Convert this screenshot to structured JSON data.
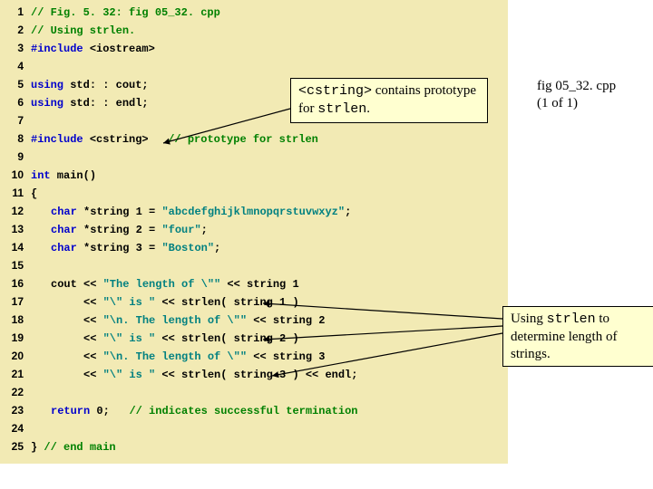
{
  "file_label": {
    "name": "fig 05_32. cpp",
    "page": "(1 of 1)"
  },
  "callouts": {
    "c1_a": "<cstring>",
    "c1_b": " contains prototype for ",
    "c1_c": "strlen",
    "c1_d": ".",
    "c2_a": "Using ",
    "c2_b": "strlen",
    "c2_c": " to determine length of strings."
  },
  "code": {
    "l1": "// Fig. 5. 32: fig 05_32. cpp",
    "l2": "// Using strlen.",
    "l3a": "#include ",
    "l3b": "<iostream>",
    "l5a": "using ",
    "l5b": "std: : cout;",
    "l6a": "using ",
    "l6b": "std: : endl;",
    "l8a": "#include ",
    "l8b": "<cstring>",
    "l8c": "   ",
    "l8d": "// prototype for strlen",
    "l10a": "int",
    "l10b": " main()",
    "l11": "{",
    "l12a": "char",
    "l12b": " *string 1 = ",
    "l12c": "\"abcdefghijklmnopqrstuvwxyz\"",
    "l12d": ";",
    "l13a": "char",
    "l13b": " *string 2 = ",
    "l13c": "\"four\"",
    "l13d": ";",
    "l14a": "char",
    "l14b": " *string 3 = ",
    "l14c": "\"Boston\"",
    "l14d": ";",
    "l16a": "cout << ",
    "l16b": "\"The length of \\\"\"",
    "l16c": " << string 1",
    "l17a": "     << ",
    "l17b": "\"\\\" is \"",
    "l17c": " << strlen( string 1 )",
    "l18a": "     << ",
    "l18b": "\"\\n. The length of \\\"\"",
    "l18c": " << string 2",
    "l19a": "     << ",
    "l19b": "\"\\\" is \"",
    "l19c": " << strlen( string 2 )",
    "l20a": "     << ",
    "l20b": "\"\\n. The length of \\\"\"",
    "l20c": " << string 3",
    "l21a": "     << ",
    "l21b": "\"\\\" is \"",
    "l21c": " << strlen( string 3 ) << endl;",
    "l23a": "return",
    "l23b": " ",
    "l23c": "0",
    "l23d": ";   ",
    "l23e": "// indicates successful termination",
    "l25a": "} ",
    "l25b": "// end main"
  },
  "gutter": {
    "g1": "1",
    "g2": "2",
    "g3": "3",
    "g4": "4",
    "g5": "5",
    "g6": "6",
    "g7": "7",
    "g8": "8",
    "g9": "9",
    "g10": "10",
    "g11": "11",
    "g12": "12",
    "g13": "13",
    "g14": "14",
    "g15": "15",
    "g16": "16",
    "g17": "17",
    "g18": "18",
    "g19": "19",
    "g20": "20",
    "g21": "21",
    "g22": "22",
    "g23": "23",
    "g24": "24",
    "g25": "25"
  }
}
